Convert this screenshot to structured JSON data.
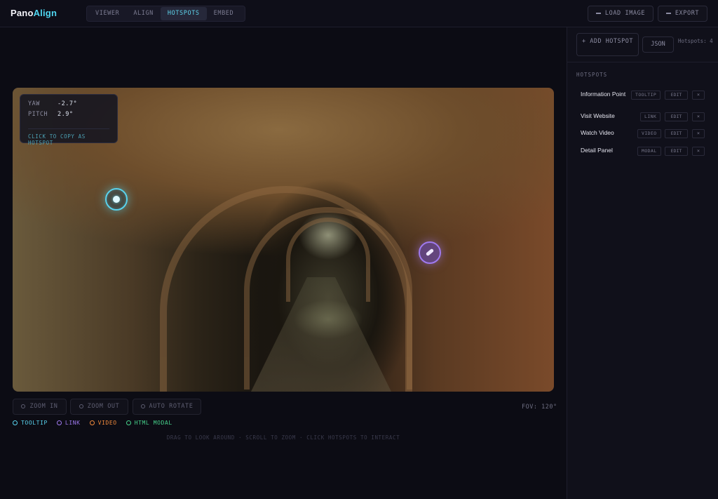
{
  "app": {
    "logo_part1": "Pano",
    "logo_part2": "Align"
  },
  "nav": {
    "tabs": [
      {
        "label": "VIEWER"
      },
      {
        "label": "ALIGN"
      },
      {
        "label": "HOTSPOTS",
        "active": true
      },
      {
        "label": "EMBED"
      }
    ]
  },
  "toolbar": {
    "load_label": "LOAD IMAGE",
    "export_label": "EXPORT"
  },
  "coords": {
    "yaw_label": "YAW",
    "yaw_value": "-2.7°",
    "pitch_label": "PITCH",
    "pitch_value": "2.9°",
    "copy_hint": "CLICK TO COPY AS HOTSPOT"
  },
  "controls": {
    "zoom_in": "ZOOM IN",
    "zoom_out": "ZOOM OUT",
    "auto_rotate": "AUTO ROTATE",
    "fov": "FOV: 120°"
  },
  "legend": [
    {
      "label": "TOOLTIP",
      "color": "#59d3ee"
    },
    {
      "label": "LINK",
      "color": "#a07af0"
    },
    {
      "label": "VIDEO",
      "color": "#f08a3c"
    },
    {
      "label": "HTML MODAL",
      "color": "#46d08a"
    }
  ],
  "help": "DRAG TO LOOK AROUND · SCROLL TO ZOOM · CLICK HOTSPOTS TO INTERACT",
  "sidebar": {
    "add_label": "+ ADD HOTSPOT",
    "json_label": "JSON",
    "count_label": "Hotspots: 4",
    "section_title": "HOTSPOTS",
    "edit_label": "EDIT",
    "delete_label": "×",
    "items": [
      {
        "name": "Information Point",
        "type": "TOOLTIP"
      },
      {
        "name": "Visit Website",
        "type": "LINK"
      },
      {
        "name": "Watch Video",
        "type": "VIDEO"
      },
      {
        "name": "Detail Panel",
        "type": "MODAL"
      }
    ]
  },
  "colors": {
    "accent": "#5fd4ec",
    "tooltip": "#59d3ee",
    "link": "#a07af0",
    "video": "#f08a3c",
    "modal": "#46d08a"
  }
}
